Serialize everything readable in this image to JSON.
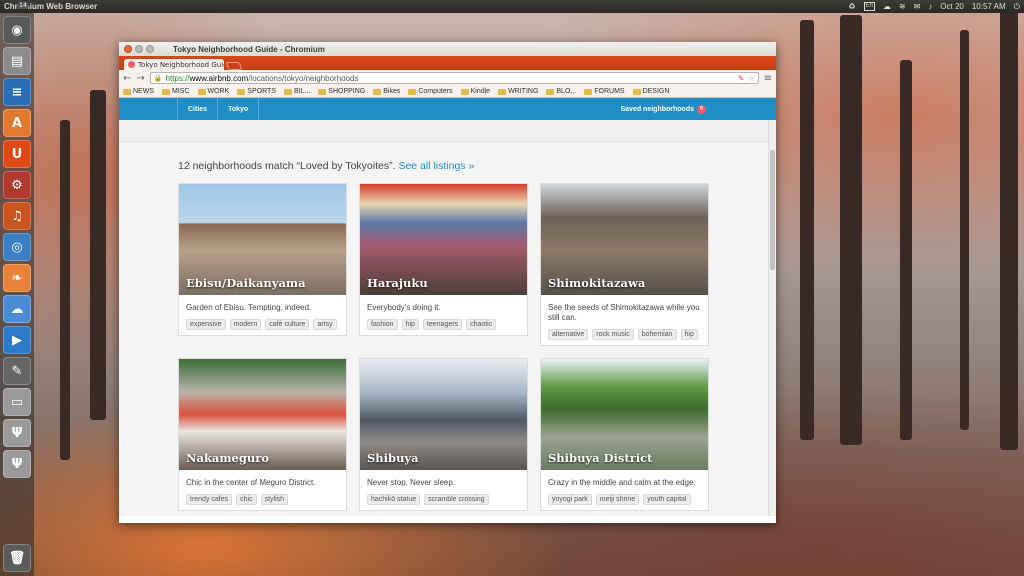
{
  "top_panel": {
    "app_name": "Chromium Web Browser",
    "keyboard": "En",
    "date": "Oct 20",
    "time": "10:57 AM"
  },
  "launcher": {
    "items": [
      {
        "name": "ubuntu-dash-icon",
        "glyph": "◉",
        "color": "#5a5a5a"
      },
      {
        "name": "files-icon",
        "glyph": "▤",
        "color": "#8b8b8b"
      },
      {
        "name": "writer-icon",
        "glyph": "≡",
        "color": "#2a6fb5"
      },
      {
        "name": "software-center-icon",
        "glyph": "A",
        "color": "#e07a2e"
      },
      {
        "name": "ubuntu-one-icon",
        "glyph": "U",
        "color": "#dd4814"
      },
      {
        "name": "settings-icon",
        "glyph": "⚙",
        "color": "#b03a2e"
      },
      {
        "name": "audio-icon",
        "glyph": "♫",
        "color": "#c9541f"
      },
      {
        "name": "chromium-icon",
        "glyph": "◎",
        "color": "#3a7fc4"
      },
      {
        "name": "leaf-icon",
        "glyph": "❧",
        "color": "#e8813a"
      },
      {
        "name": "weather-icon",
        "glyph": "☁",
        "color": "#4b8bd4"
      },
      {
        "name": "media-player-icon",
        "glyph": "▶",
        "color": "#2f79c9"
      },
      {
        "name": "tool-icon",
        "glyph": "✎",
        "color": "#666666"
      },
      {
        "name": "drive-icon",
        "glyph": "▭",
        "color": "#9a9a9a"
      },
      {
        "name": "usb-drive-icon",
        "glyph": "Ψ",
        "color": "#9a9a9a"
      },
      {
        "name": "usb-drive-icon-2",
        "glyph": "Ψ",
        "color": "#9a9a9a"
      }
    ],
    "badge": "14",
    "trash_glyph": "🗑"
  },
  "window": {
    "title": "Tokyo Neighborhood Guide - Chromium"
  },
  "tab": {
    "title": "Tokyo Neighborhood Guide",
    "close": "×"
  },
  "toolbar": {
    "back": "←",
    "forward": "→",
    "url_scheme": "https://",
    "url_host": "www.airbnb.com",
    "url_path": "/locations/tokyo/neighborhoods",
    "star": "☆",
    "menu": "≡"
  },
  "bookmarks": [
    "NEWS",
    "MISC",
    "WORK",
    "SPORTS",
    "BIL...",
    "SHOPPING",
    "Bikes",
    "Computers",
    "Kindle",
    "WRITING",
    "BLO...",
    "FORUMS",
    "DESIGN"
  ],
  "site_nav": {
    "cities": "Cities",
    "tokyo": "Tokyo",
    "saved": "Saved neighborhoods",
    "saved_count": "0"
  },
  "results": {
    "count_text": "12 neighborhoods match “Loved by Tokyoites”.",
    "see_all": "See all listings »"
  },
  "neighborhoods": [
    {
      "name": "Ebisu/Daikanyama",
      "description": "Garden of Ebisu. Tempting, indeed.",
      "tags": [
        "expensive",
        "modern",
        "café culture",
        "artsy"
      ]
    },
    {
      "name": "Harajuku",
      "description": "Everybody's doing it.",
      "tags": [
        "fashion",
        "hip",
        "teenagers",
        "chaotic"
      ]
    },
    {
      "name": "Shimokitazawa",
      "description": "See the seeds of Shimokitazawa while you still can.",
      "tags": [
        "alternative",
        "rock music",
        "bohemian",
        "hip"
      ]
    },
    {
      "name": "Nakameguro",
      "description": "Chic in the center of Meguro District.",
      "tags": [
        "trendy cafes",
        "chic",
        "stylish"
      ]
    },
    {
      "name": "Shibuya",
      "description": "Never stop. Never sleep.",
      "tags": [
        "hachikō statue",
        "scramble crossing"
      ]
    },
    {
      "name": "Shibuya District",
      "description": "Crazy in the middle and calm at the edge.",
      "tags": [
        "yoyogi park",
        "meiji shrine",
        "youth capital"
      ]
    }
  ]
}
